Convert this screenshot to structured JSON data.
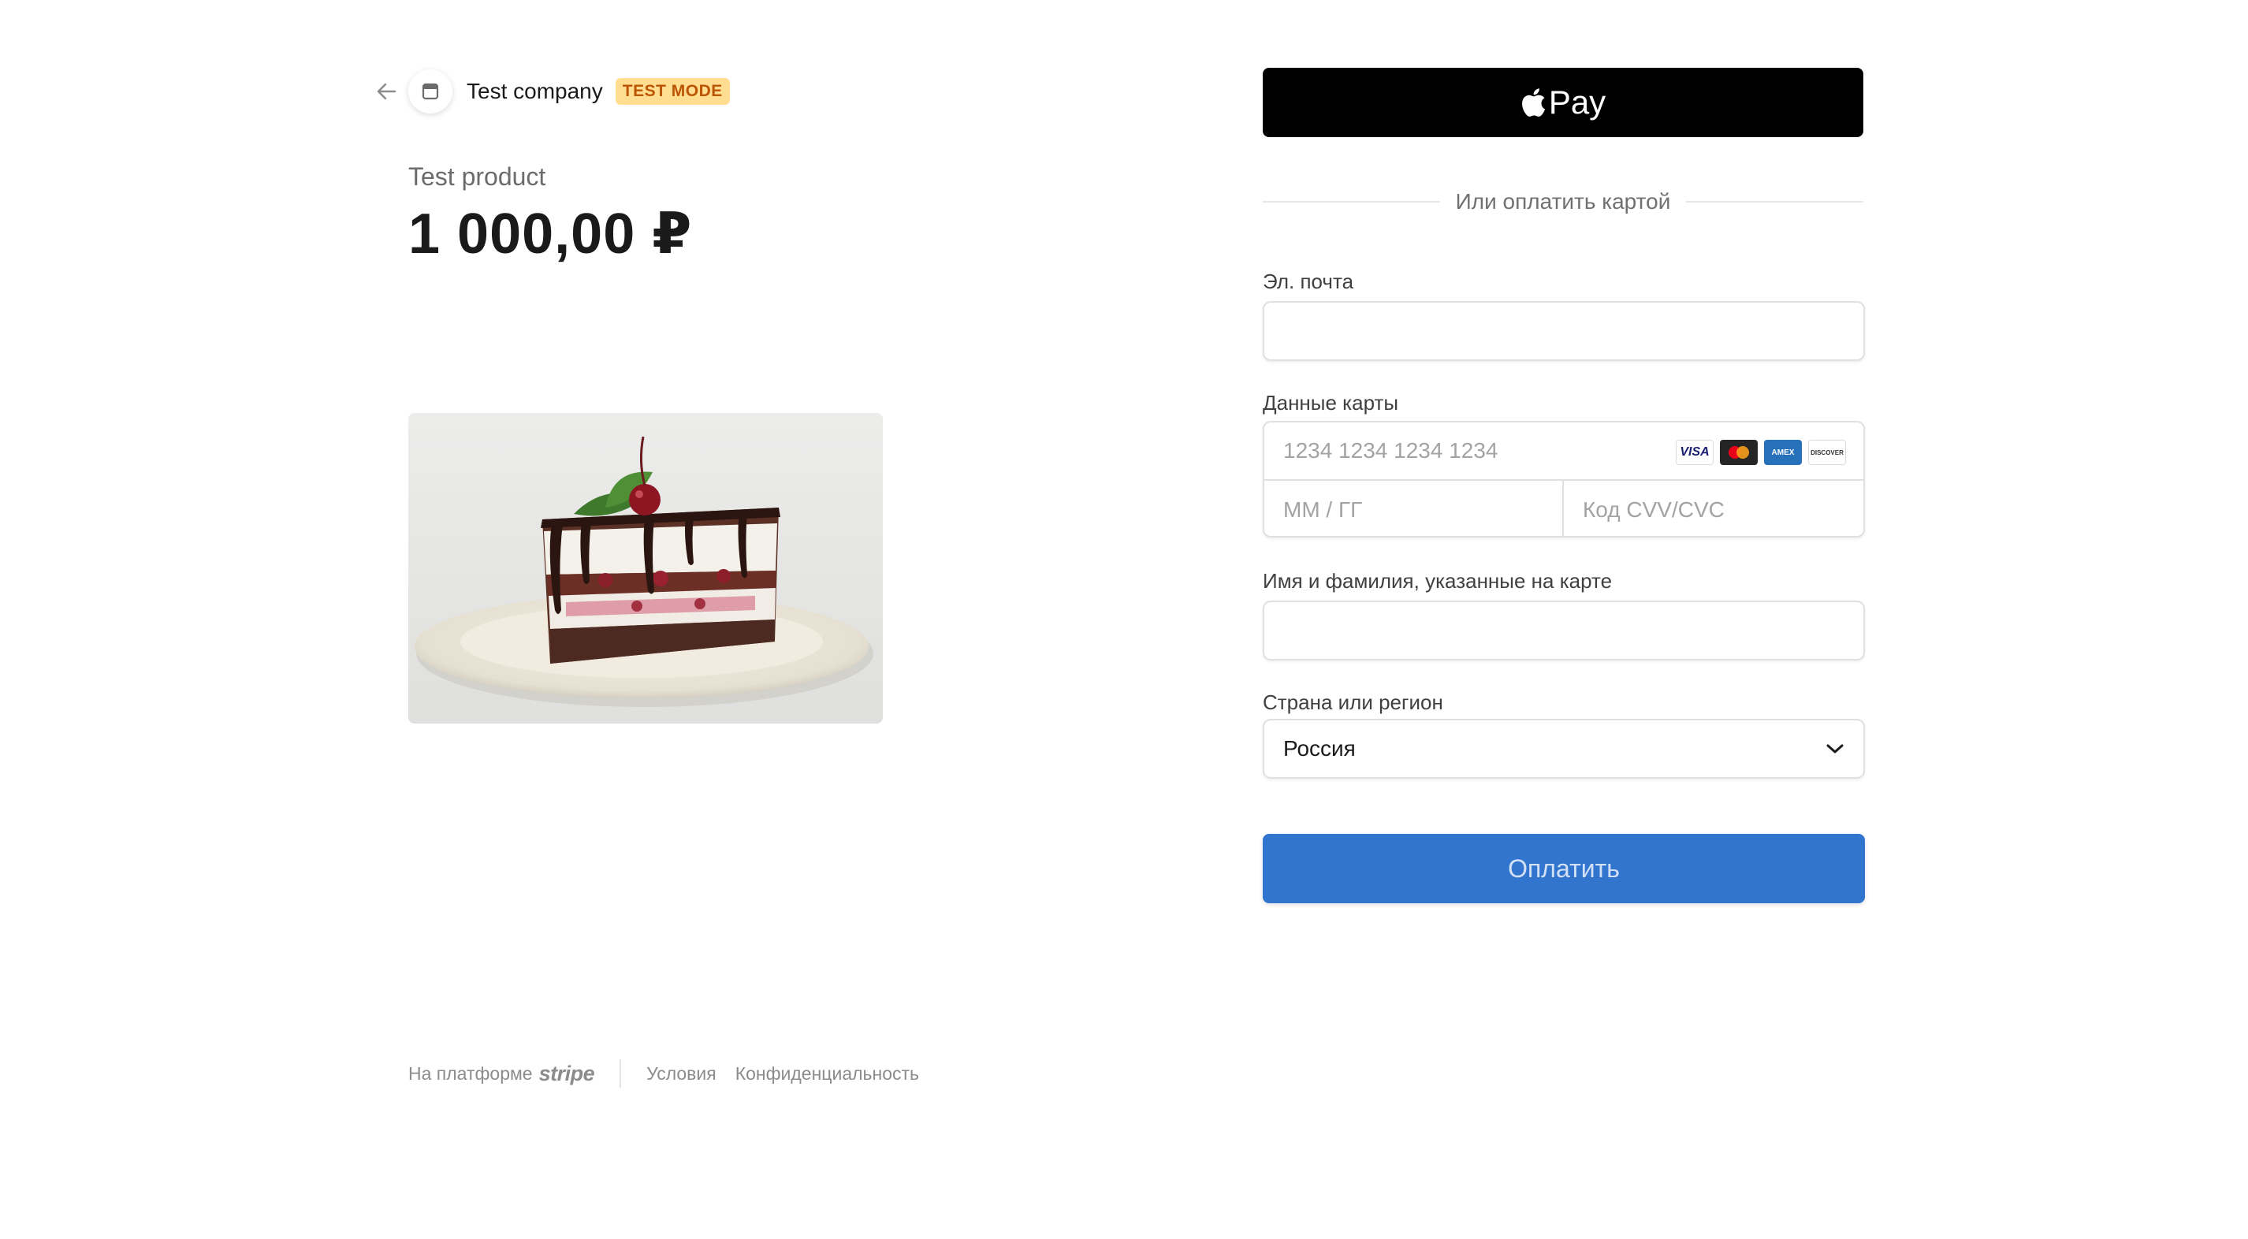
{
  "header": {
    "company_name": "Test company",
    "test_badge": "TEST MODE"
  },
  "product": {
    "name": "Test product",
    "price": "1 000,00 ₽"
  },
  "footer": {
    "powered_by": "На платформе",
    "brand": "stripe",
    "terms": "Условия",
    "privacy": "Конфиденциальность"
  },
  "payment": {
    "apple_pay_label": "Pay",
    "or_divider": "Или оплатить картой",
    "email_label": "Эл. почта",
    "email_value": "",
    "card_label": "Данные карты",
    "card_number_placeholder": "1234 1234 1234 1234",
    "card_brands": [
      "VISA",
      "mastercard",
      "AMEX",
      "DISCOVER"
    ],
    "expiry_placeholder": "ММ / ГГ",
    "cvc_placeholder": "Код CVV/CVC",
    "name_label": "Имя и фамилия, указанные на карте",
    "name_value": "",
    "country_label": "Страна или регион",
    "country_value": "Россия",
    "pay_button": "Оплатить"
  },
  "colors": {
    "accent": "#3275cf",
    "badge_bg": "#ffde92",
    "badge_text": "#bb5504"
  }
}
